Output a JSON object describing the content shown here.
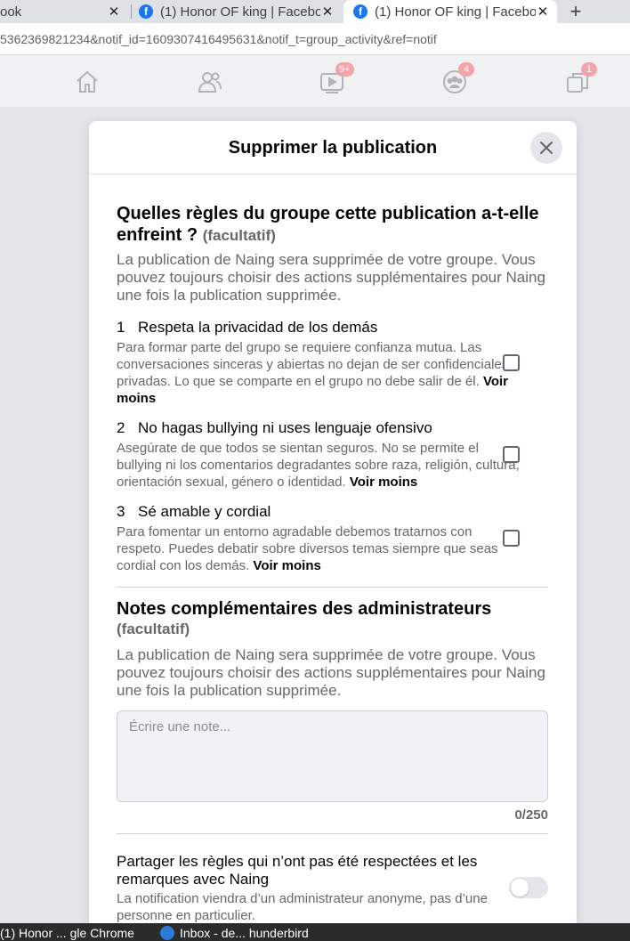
{
  "browser": {
    "tabs": [
      {
        "label": "ook",
        "close": "✕"
      },
      {
        "label": "(1) Honor OF king | Facebook",
        "close": "✕",
        "favicon": "f"
      },
      {
        "label": "(1) Honor OF king | Facebook",
        "close": "✕",
        "favicon": "f",
        "active": true
      }
    ],
    "new_tab": "+",
    "url": "5362369821234&notif_id=1609307416495631&notif_t=group_activity&ref=notif"
  },
  "fb_nav": {
    "items": [
      {
        "icon": "home-icon",
        "badge": ""
      },
      {
        "icon": "friends-icon",
        "badge": ""
      },
      {
        "icon": "watch-icon",
        "badge": "9+"
      },
      {
        "icon": "groups-icon",
        "badge": "4"
      },
      {
        "icon": "gaming-icon",
        "badge": "1"
      }
    ]
  },
  "modal": {
    "title": "Supprimer la publication",
    "rules_section": {
      "heading": "Quelles règles du groupe cette publication a-t-elle enfreint ?",
      "optional": "(facultatif)",
      "helper": "La publication de Naing sera supprimée de votre groupe. Vous pouvez toujours choisir des actions supplémentaires pour Naing une fois la publication supprimée."
    },
    "rules": [
      {
        "number": "1",
        "title": "Respeta la privacidad de los demás",
        "description": "Para formar parte del grupo se requiere confianza mutua. Las conversaciones sinceras y abiertas no dejan de ser confidenciales y privadas. Lo que se comparte en el grupo no debe salir de él.",
        "see_less": "Voir moins",
        "checked": false
      },
      {
        "number": "2",
        "title": "No hagas bullying ni uses lenguaje ofensivo",
        "description": "Asegúrate de que todos se sientan seguros. No se permite el bullying ni los comentarios degradantes sobre raza, religión, cultura, orientación sexual, género o identidad.",
        "see_less": "Voir moins",
        "checked": false
      },
      {
        "number": "3",
        "title": "Sé amable y cordial",
        "description": "Para fomentar un entorno agradable debemos tratarnos con respeto. Puedes debatir sobre diversos temas siempre que seas cordial con los demás.",
        "see_less": "Voir moins",
        "checked": false
      }
    ],
    "notes_section": {
      "heading": "Notes complémentaires des administrateurs",
      "optional": "(facultatif)",
      "helper": "La publication de Naing sera supprimée de votre groupe. Vous pouvez toujours choisir des actions supplémentaires pour Naing une fois la publication supprimée.",
      "note_value": "",
      "note_placeholder": "Écrire une note...",
      "counter": "0/250"
    },
    "share": {
      "title": "Partager les règles qui n’ont pas été respectées et les remarques avec Naing",
      "description": "La notification viendra d’un administrateur anonyme, pas d’une personne en particulier.",
      "toggle_on": false
    }
  },
  "taskbar": {
    "items": [
      {
        "label": "(1) Honor ... gle Chrome"
      },
      {
        "label": "Inbox - de... hunderbird"
      }
    ]
  },
  "colors": {
    "accent": "#1877f2",
    "badge": "#f4a3a9",
    "secondary_text": "#65676b"
  }
}
